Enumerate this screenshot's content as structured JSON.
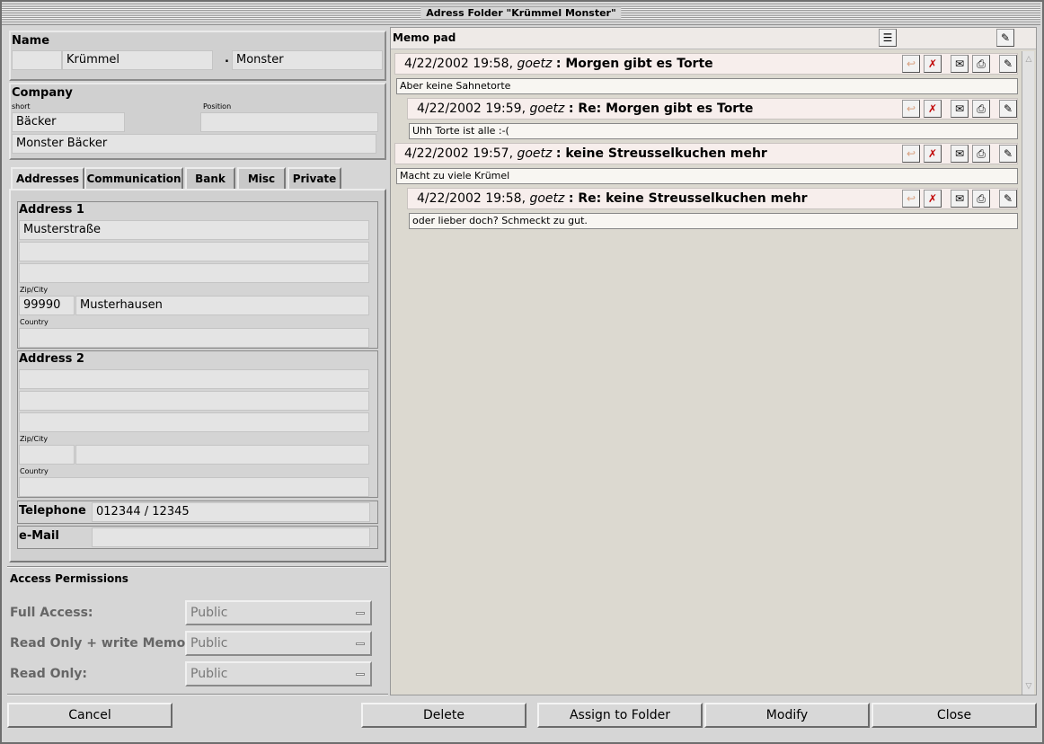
{
  "window": {
    "title": "Adress Folder \"Krümmel Monster\""
  },
  "name_section": {
    "label": "Name",
    "first_name": "Krümmel",
    "separator": ".",
    "last_name": "Monster"
  },
  "company": {
    "label": "Company",
    "short_label": "short",
    "position_label": "Position",
    "short": "Bäcker",
    "position": "",
    "full_name": "Monster Bäcker"
  },
  "tabs": [
    "Addresses",
    "Communication",
    "Bank",
    "Misc",
    "Private"
  ],
  "address1": {
    "label": "Address 1",
    "street": "Musterstraße",
    "line2": "",
    "line3": "",
    "zip_city_label": "Zip/City",
    "zip": "99990",
    "city": "Musterhausen",
    "country_label": "Country",
    "country": ""
  },
  "address2": {
    "label": "Address 2",
    "street": "",
    "line2": "",
    "line3": "",
    "zip_city_label": "Zip/City",
    "zip": "",
    "city": "",
    "country_label": "Country",
    "country": ""
  },
  "telephone": {
    "label": "Telephone",
    "value": "012344 / 12345"
  },
  "email": {
    "label": "e-Mail",
    "value": ""
  },
  "permissions": {
    "title": "Access Permissions",
    "full_access": {
      "label": "Full Access:",
      "value": "Public"
    },
    "read_write_memo": {
      "label": "Read Only + write Memo :",
      "value": "Public"
    },
    "read_only": {
      "label": "Read Only:",
      "value": "Public"
    }
  },
  "memo": {
    "title": "Memo pad",
    "items": [
      {
        "date": "4/22/2002 19:58,",
        "user": "goetz",
        "subject": "Morgen gibt es Torte",
        "body": "Aber keine Sahnetorte"
      },
      {
        "date": "4/22/2002 19:59,",
        "user": "goetz",
        "subject": "Re:  Morgen gibt es Torte",
        "body": "Uhh Torte ist alle :-("
      },
      {
        "date": "4/22/2002 19:57,",
        "user": "goetz",
        "subject": "keine Streusselkuchen mehr",
        "body": "Macht zu viele Krümel"
      },
      {
        "date": "4/22/2002 19:58,",
        "user": "goetz",
        "subject": "Re:  keine Streusselkuchen mehr",
        "body": "oder lieber doch? Schmeckt zu gut."
      }
    ]
  },
  "buttons": {
    "cancel": "Cancel",
    "delete": "Delete",
    "assign": "Assign to Folder",
    "modify": "Modify",
    "close": "Close"
  },
  "icons": {
    "reply": "reply-icon",
    "delete": "delete-icon",
    "mail": "mail-icon",
    "print": "print-icon",
    "edit": "edit-icon",
    "tree": "tree-icon"
  }
}
